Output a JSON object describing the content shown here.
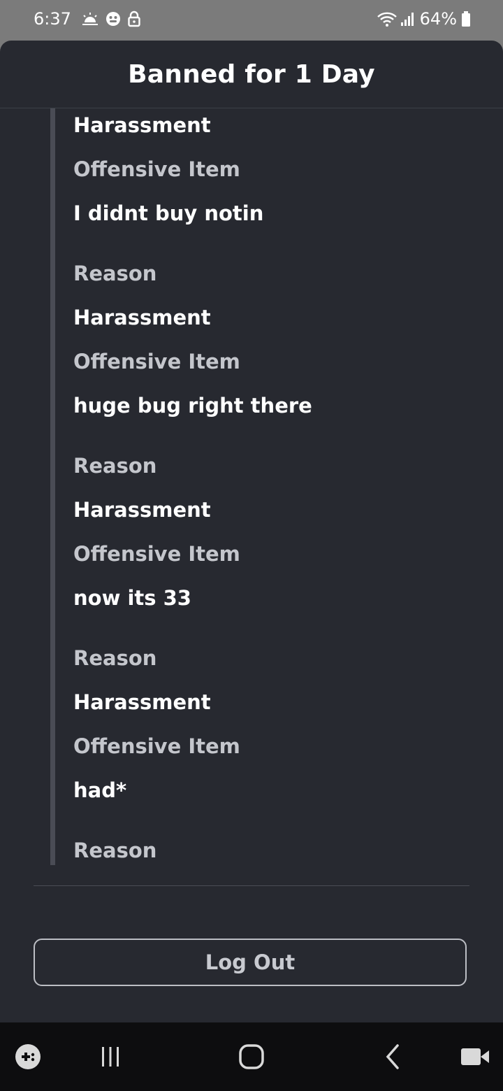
{
  "status_bar": {
    "time": "6:37",
    "battery": "64%"
  },
  "modal": {
    "title": "Banned for 1 Day"
  },
  "lines": [
    {
      "kind": "value",
      "text": "Harassment"
    },
    {
      "kind": "label",
      "text": "Offensive Item"
    },
    {
      "kind": "value",
      "text": "I didnt buy notin"
    },
    {
      "kind": "label",
      "text": "Reason"
    },
    {
      "kind": "value",
      "text": "Harassment"
    },
    {
      "kind": "label",
      "text": "Offensive Item"
    },
    {
      "kind": "value",
      "text": "huge bug right there"
    },
    {
      "kind": "label",
      "text": "Reason"
    },
    {
      "kind": "value",
      "text": "Harassment"
    },
    {
      "kind": "label",
      "text": "Offensive Item"
    },
    {
      "kind": "value",
      "text": "now its 33"
    },
    {
      "kind": "label",
      "text": "Reason"
    },
    {
      "kind": "value",
      "text": "Harassment"
    },
    {
      "kind": "label",
      "text": "Offensive Item"
    },
    {
      "kind": "value",
      "text": "had*"
    },
    {
      "kind": "label",
      "text": "Reason"
    }
  ],
  "actions": {
    "logout_label": "Log Out"
  },
  "colors": {
    "panel_background": "#272930",
    "label_text": "#c4c6cc",
    "value_text": "#ffffff"
  },
  "nav_icons": [
    "game-launcher-icon",
    "recent-apps-icon",
    "home-icon",
    "back-icon",
    "video-record-icon"
  ]
}
